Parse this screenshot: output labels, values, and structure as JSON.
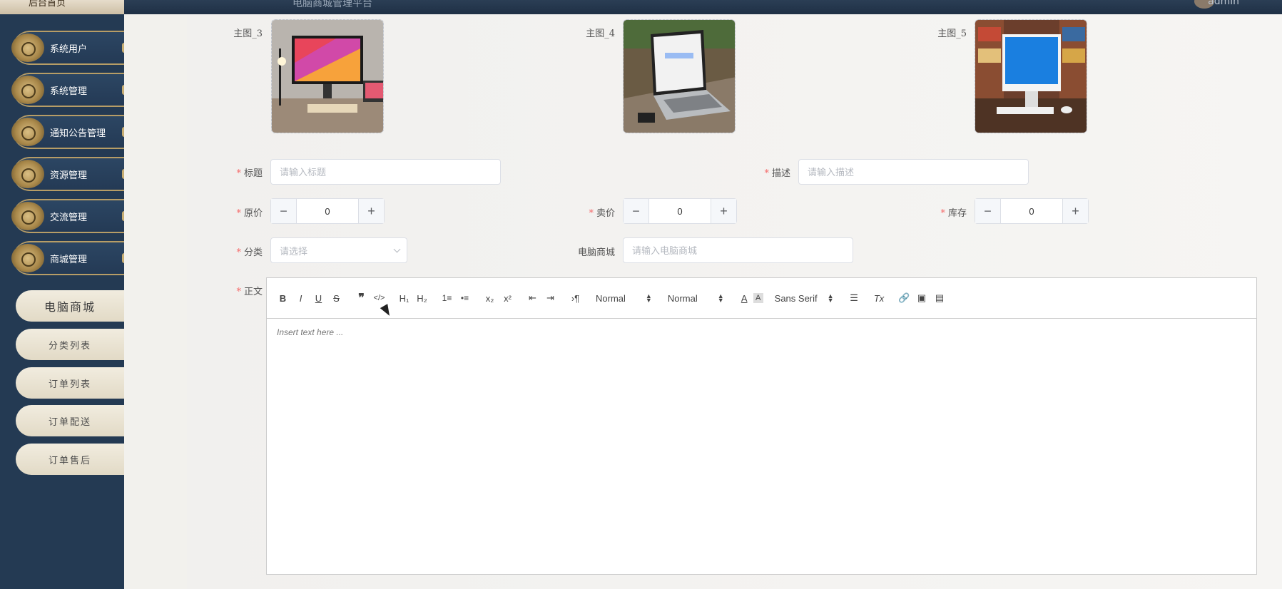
{
  "topbar": {
    "logo_text": "后台首页",
    "title": "电脑商城管理平台",
    "user": "admin"
  },
  "sidebar": {
    "items": [
      {
        "label": "系统用户"
      },
      {
        "label": "系统管理"
      },
      {
        "label": "通知公告管理"
      },
      {
        "label": "资源管理"
      },
      {
        "label": "交流管理"
      },
      {
        "label": "商城管理"
      }
    ],
    "subitems": [
      {
        "label": "电脑商城"
      },
      {
        "label": "分类列表"
      },
      {
        "label": "订单列表"
      },
      {
        "label": "订单配送"
      },
      {
        "label": "订单售后"
      }
    ]
  },
  "form": {
    "images": [
      {
        "label": "主图_3"
      },
      {
        "label": "主图_4"
      },
      {
        "label": "主图_5"
      }
    ],
    "title": {
      "label": "标题",
      "placeholder": "请输入标题"
    },
    "description": {
      "label": "描述",
      "placeholder": "请输入描述"
    },
    "original_price": {
      "label": "原价",
      "value": "0"
    },
    "sale_price": {
      "label": "卖价",
      "value": "0"
    },
    "stock": {
      "label": "库存",
      "value": "0"
    },
    "category": {
      "label": "分类",
      "placeholder": "请选择"
    },
    "store": {
      "label": "电脑商城",
      "placeholder": "请输入电脑商城"
    },
    "body": {
      "label": "正文"
    }
  },
  "editor": {
    "toolbar": {
      "bold": "B",
      "italic": "I",
      "underline": "U",
      "strike": "S",
      "quote": "❞",
      "code": "</>",
      "h1": "H₁",
      "h2": "H₂",
      "ordered": "1≡",
      "bullet": "•≡",
      "sub": "x₂",
      "sup": "x²",
      "outdent": "⇤",
      "indent": "⇥",
      "direction": "›¶",
      "size_value": "Normal",
      "header_value": "Normal",
      "color": "A",
      "background": "A",
      "font_value": "Sans Serif",
      "align": "☰",
      "clean": "Tx",
      "link": "🔗",
      "image": "▣",
      "video": "▤"
    },
    "placeholder": "Insert text here ..."
  }
}
